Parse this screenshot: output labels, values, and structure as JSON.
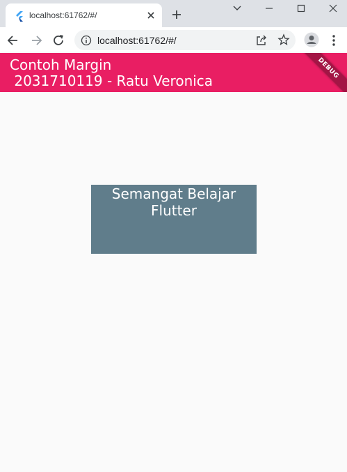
{
  "browser": {
    "tab": {
      "title": "localhost:61762/#/"
    },
    "url": "localhost:61762/#/",
    "icons": {
      "favicon": "flutter-logo-icon",
      "tab_close": "close-icon",
      "new_tab": "plus-icon",
      "minimize": "minimize-icon",
      "maximize": "maximize-icon",
      "close_window": "close-icon",
      "back": "arrow-left-icon",
      "forward": "arrow-right-icon",
      "reload": "reload-icon",
      "site_info": "info-icon",
      "share": "share-icon",
      "bookmark": "star-icon",
      "profile": "person-icon",
      "menu": "kebab-menu-icon"
    }
  },
  "app": {
    "appbar_title": "Contoh Margin\n 2031710119 - Ratu Veronica",
    "debug_banner": "DEBUG",
    "box_text": "Semangat Belajar Flutter",
    "colors": {
      "appbar": "#e91e63",
      "box": "#607d8b",
      "background": "#fafafa"
    }
  }
}
